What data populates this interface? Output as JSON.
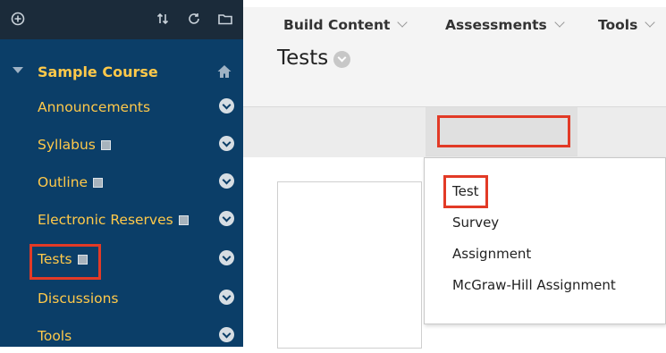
{
  "sidebar": {
    "toolbar_icons": [
      "add-icon",
      "sort-icon",
      "refresh-icon",
      "folder-icon"
    ],
    "course": {
      "title": "Sample Course",
      "icon": "home-icon"
    },
    "items": [
      {
        "label": "Announcements",
        "icon": ""
      },
      {
        "label": "Syllabus",
        "icon": "page-icon"
      },
      {
        "label": "Outline",
        "icon": "page-icon"
      },
      {
        "label": "Electronic Reserves",
        "icon": "page-icon"
      },
      {
        "label": "Tests",
        "icon": "page-icon",
        "highlighted": true
      },
      {
        "label": "Discussions",
        "icon": ""
      },
      {
        "label": "Tools",
        "icon": ""
      }
    ]
  },
  "main": {
    "page_title": "Tests",
    "action_bar": {
      "build_content": "Build Content",
      "assessments": "Assessments",
      "tools": "Tools"
    },
    "assessments_menu": [
      "Test",
      "Survey",
      "Assignment",
      "McGraw-Hill Assignment"
    ]
  },
  "colors": {
    "sidebar_bg": "#0b3e68",
    "sidebar_text": "#ffc94a",
    "highlight_border": "#e23a26"
  }
}
